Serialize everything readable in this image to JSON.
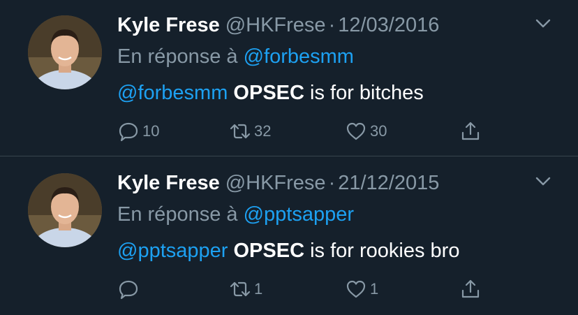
{
  "tweets": [
    {
      "name": "Kyle Frese",
      "handle": "@HKFrese",
      "separator": "·",
      "date": "12/03/2016",
      "reply_prefix": "En réponse à",
      "reply_to": "@forbesmm",
      "text_mention": "@forbesmm",
      "text_bold": "OPSEC",
      "text_rest": "is for bitches",
      "replies": "10",
      "retweets": "32",
      "likes": "30"
    },
    {
      "name": "Kyle Frese",
      "handle": "@HKFrese",
      "separator": "·",
      "date": "21/12/2015",
      "reply_prefix": "En réponse à",
      "reply_to": "@pptsapper",
      "text_mention": "@pptsapper",
      "text_bold": "OPSEC",
      "text_rest": "is for rookies bro",
      "replies": "",
      "retweets": "1",
      "likes": "1"
    }
  ],
  "icons": {
    "reply": "reply-icon",
    "retweet": "retweet-icon",
    "like": "heart-icon",
    "share": "share-icon",
    "menu": "chevron-down-icon"
  },
  "colors": {
    "background": "#15202b",
    "secondary_text": "#8899a6",
    "link": "#1da1f2",
    "divider": "#38444d"
  }
}
